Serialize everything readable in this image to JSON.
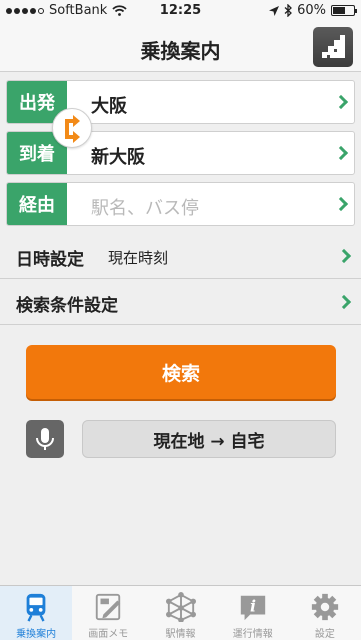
{
  "status_bar": {
    "carrier": "SoftBank",
    "time": "12:25",
    "battery": "60%",
    "battery_level": 0.6
  },
  "nav": {
    "title": "乗換案内"
  },
  "form": {
    "departure": {
      "tag": "出発",
      "value": "大阪"
    },
    "arrival": {
      "tag": "到着",
      "value": "新大阪"
    },
    "via": {
      "tag": "経由",
      "placeholder": "駅名、バス停"
    }
  },
  "settings": {
    "datetime": {
      "label": "日時設定",
      "value": "現在時刻"
    },
    "conditions": {
      "label": "検索条件設定"
    }
  },
  "search_button": "検索",
  "home_button": "現在地 → 自宅",
  "tabs": [
    {
      "label": "乗換案内",
      "icon": "train-icon",
      "active": true
    },
    {
      "label": "画面メモ",
      "icon": "memo-icon",
      "active": false
    },
    {
      "label": "駅情報",
      "icon": "station-network-icon",
      "active": false
    },
    {
      "label": "運行情報",
      "icon": "info-icon",
      "active": false
    },
    {
      "label": "設定",
      "icon": "gear-icon",
      "active": false
    }
  ],
  "colors": {
    "accent_green": "#3aa46a",
    "search_orange": "#f2780c",
    "active_blue": "#1e7fd8",
    "swap_orange": "#f28a18"
  }
}
